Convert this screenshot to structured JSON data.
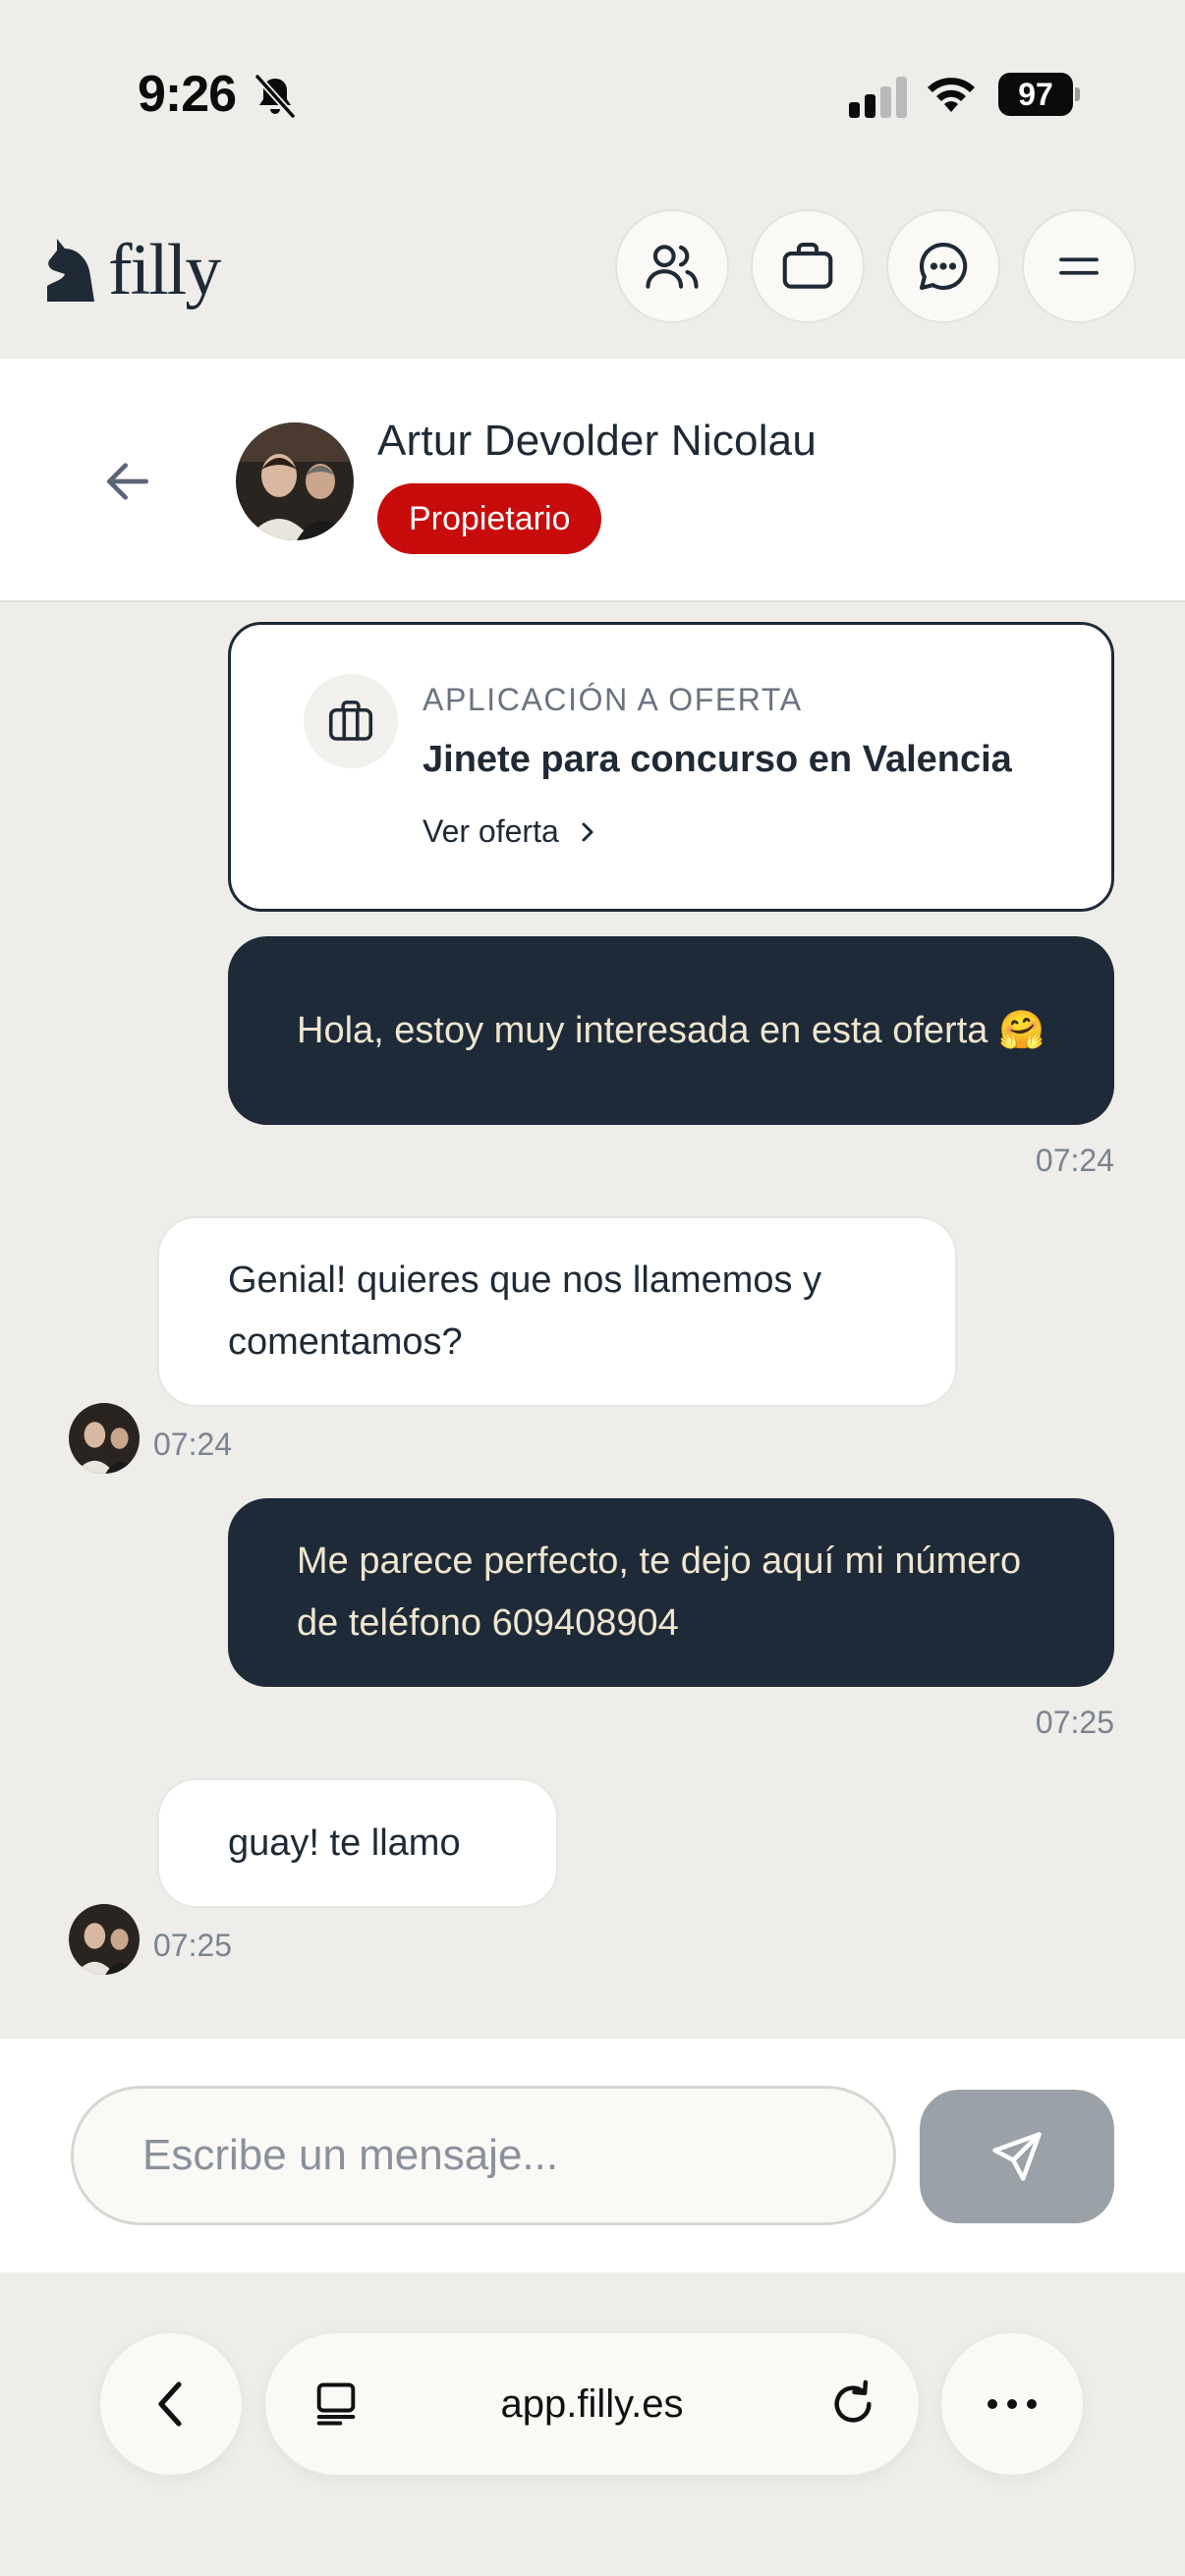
{
  "status_bar": {
    "time": "9:26",
    "battery": "97"
  },
  "header": {
    "logo_text": "filly",
    "buttons": [
      "users-icon",
      "briefcase-icon",
      "chat-icon",
      "menu-icon"
    ]
  },
  "chat": {
    "contact_name": "Artur Devolder Nicolau",
    "role": "Propietario"
  },
  "offer": {
    "kicker": "APLICACIÓN A OFERTA",
    "title": "Jinete para concurso en Valencia",
    "link_label": "Ver oferta"
  },
  "messages": [
    {
      "direction": "out",
      "text": "Hola, estoy muy interesada en esta oferta 🤗",
      "time": "07:24"
    },
    {
      "direction": "in",
      "text": "Genial! quieres que nos llamemos y comentamos?",
      "time": "07:24"
    },
    {
      "direction": "out",
      "text": "Me parece perfecto, te dejo aquí mi número de teléfono 609408904",
      "time": "07:25"
    },
    {
      "direction": "in",
      "text": "guay! te llamo",
      "time": "07:25"
    }
  ],
  "composer": {
    "placeholder": "Escribe un mensaje..."
  },
  "browser": {
    "url": "app.filly.es"
  },
  "colors": {
    "background": "#eeedea",
    "primary_dark": "#1e2a38",
    "badge_red": "#c80b0b",
    "outgoing_text": "#efe6cf",
    "send_button": "#9aa1a8"
  }
}
